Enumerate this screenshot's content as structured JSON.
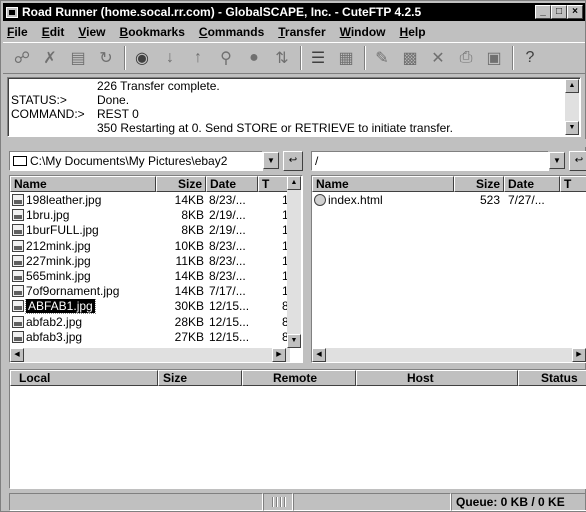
{
  "window": {
    "title": "Road Runner (home.socal.rr.com) - GlobalSCAPE, Inc. - CuteFTP 4.2.5",
    "controls": [
      "_",
      "□",
      "×"
    ]
  },
  "menu": [
    "File",
    "Edit",
    "View",
    "Bookmarks",
    "Commands",
    "Transfer",
    "Window",
    "Help"
  ],
  "toolbar_icons": [
    "quick-connect-icon",
    "disconnect-icon",
    "site-manager-icon",
    "reconnect-icon",
    "search-icon",
    "download-icon",
    "upload-icon",
    "find-icon",
    "stop-icon",
    "refresh-icon",
    "list-view-icon",
    "details-view-icon",
    "edit-icon",
    "rename-icon",
    "delete-icon",
    "print-icon",
    "folder-icon",
    "help-icon"
  ],
  "log": {
    "lines": [
      {
        "key": "",
        "text": "226 Transfer complete."
      },
      {
        "key": "STATUS:>",
        "text": "Done."
      },
      {
        "key": "COMMAND:>",
        "text": "REST 0"
      },
      {
        "key": "",
        "text": "350 Restarting at 0. Send STORE or RETRIEVE to initiate transfer."
      }
    ]
  },
  "local": {
    "path": "C:\\My Documents\\My Pictures\\ebay2",
    "columns": [
      "Name",
      "Size",
      "Date",
      "T"
    ],
    "files": [
      {
        "name": "198leather.jpg",
        "size": "14KB",
        "date": "8/23/...",
        "t": "1"
      },
      {
        "name": "1bru.jpg",
        "size": "8KB",
        "date": "2/19/...",
        "t": "1"
      },
      {
        "name": "1burFULL.jpg",
        "size": "8KB",
        "date": "2/19/...",
        "t": "1"
      },
      {
        "name": "212mink.jpg",
        "size": "10KB",
        "date": "8/23/...",
        "t": "1"
      },
      {
        "name": "227mink.jpg",
        "size": "11KB",
        "date": "8/23/...",
        "t": "1"
      },
      {
        "name": "565mink.jpg",
        "size": "14KB",
        "date": "8/23/...",
        "t": "1"
      },
      {
        "name": "7of9ornament.jpg",
        "size": "14KB",
        "date": "7/17/...",
        "t": "1"
      },
      {
        "name": "ABFAB1.jpg",
        "size": "30KB",
        "date": "12/15...",
        "t": "8"
      },
      {
        "name": "abfab2.jpg",
        "size": "28KB",
        "date": "12/15...",
        "t": "8"
      },
      {
        "name": "abfab3.jpg",
        "size": "27KB",
        "date": "12/15...",
        "t": "8"
      }
    ],
    "selected_index": 7
  },
  "remote": {
    "path": "/",
    "columns": [
      "Name",
      "Size",
      "Date",
      "T"
    ],
    "files": [
      {
        "name": "index.html",
        "size": "523",
        "date": "7/27/..."
      }
    ]
  },
  "queue": {
    "columns": [
      "Local",
      "Size",
      "Remote",
      "Host",
      "Status"
    ]
  },
  "status": {
    "queue_text": "Queue: 0 KB / 0 KE"
  }
}
